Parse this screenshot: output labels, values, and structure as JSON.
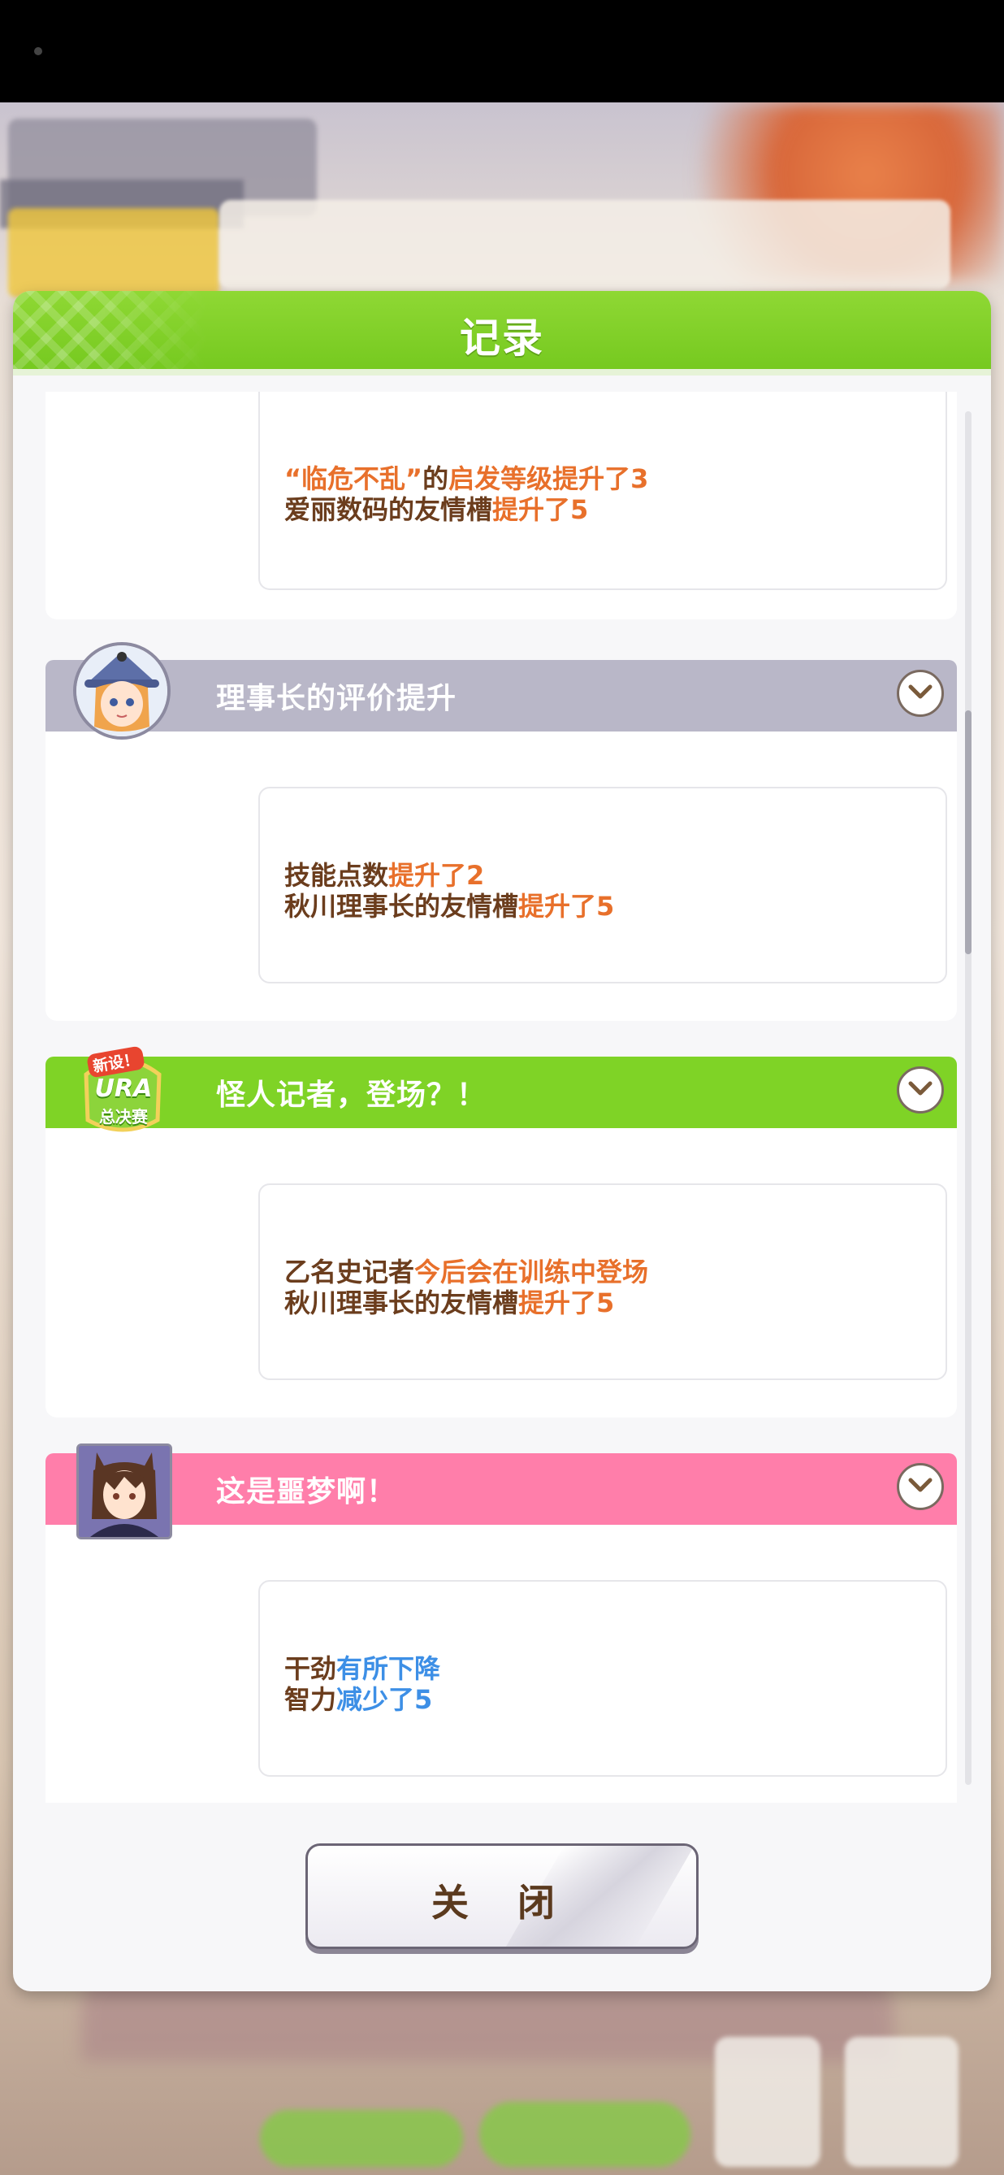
{
  "dialog": {
    "title": "记录",
    "close_label": "关 闭"
  },
  "entries": [
    {
      "lines": [
        [
          {
            "t": "“临危不乱”",
            "c": "o"
          },
          {
            "t": "的",
            "c": "n"
          },
          {
            "t": "启发等级提升了3",
            "c": "o"
          }
        ],
        [
          {
            "t": "爱丽数码的友情槽",
            "c": "n"
          },
          {
            "t": "提升了5",
            "c": "o"
          }
        ]
      ]
    },
    {
      "title": "理事长的评价提升",
      "header_color": "#b9b7c8",
      "portrait": "chairwoman-portrait",
      "lines": [
        [
          {
            "t": "技能点数",
            "c": "n"
          },
          {
            "t": "提升了2",
            "c": "o"
          }
        ],
        [
          {
            "t": "秋川理事长的友情槽",
            "c": "n"
          },
          {
            "t": "提升了5",
            "c": "o"
          }
        ]
      ]
    },
    {
      "title": "怪人记者，登场？！",
      "header_color": "#7fd326",
      "portrait": "ura-finals-badge",
      "badge_text": {
        "top": "新设！",
        "middle": "URA",
        "bottom": "总决赛"
      },
      "lines": [
        [
          {
            "t": "乙名史记者",
            "c": "n"
          },
          {
            "t": "今后会在训练中登场",
            "c": "o"
          }
        ],
        [
          {
            "t": "秋川理事长的友情槽",
            "c": "n"
          },
          {
            "t": "提升了5",
            "c": "o"
          }
        ]
      ]
    },
    {
      "title": "这是噩梦啊！",
      "header_color": "#ff7eaa",
      "portrait": "horse-girl-portrait",
      "lines": [
        [
          {
            "t": "干劲",
            "c": "n"
          },
          {
            "t": "有所下降",
            "c": "b"
          }
        ],
        [
          {
            "t": "智力",
            "c": "n"
          },
          {
            "t": "减少了5",
            "c": "b"
          }
        ]
      ]
    }
  ]
}
